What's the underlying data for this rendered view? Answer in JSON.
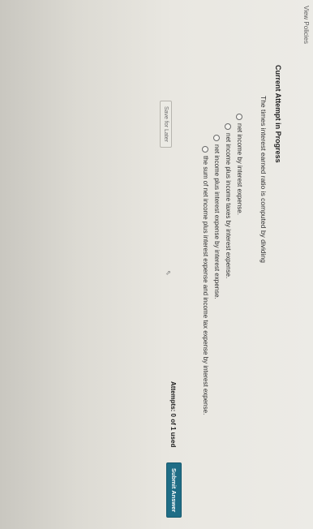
{
  "header": {
    "view_policies": "View Policies"
  },
  "attempt": {
    "heading": "Current Attempt in Progress"
  },
  "question": {
    "text": "The times interest earned ratio is computed by dividing",
    "options": [
      {
        "label": "net income by interest expense.",
        "selected": false
      },
      {
        "label": "net income plus income taxes by interest expense.",
        "selected": false
      },
      {
        "label": "net income plus interest expense by interest expense.",
        "selected": false
      },
      {
        "label": "the sum of net income plus interest expense and income tax expense by interest expense.",
        "selected": false
      }
    ]
  },
  "actions": {
    "save_label": "Save for Later",
    "attempts_text": "Attempts: 0 of 1 used",
    "submit_label": "Submit Answer"
  },
  "colors": {
    "submit_bg": "#1f6d86"
  }
}
